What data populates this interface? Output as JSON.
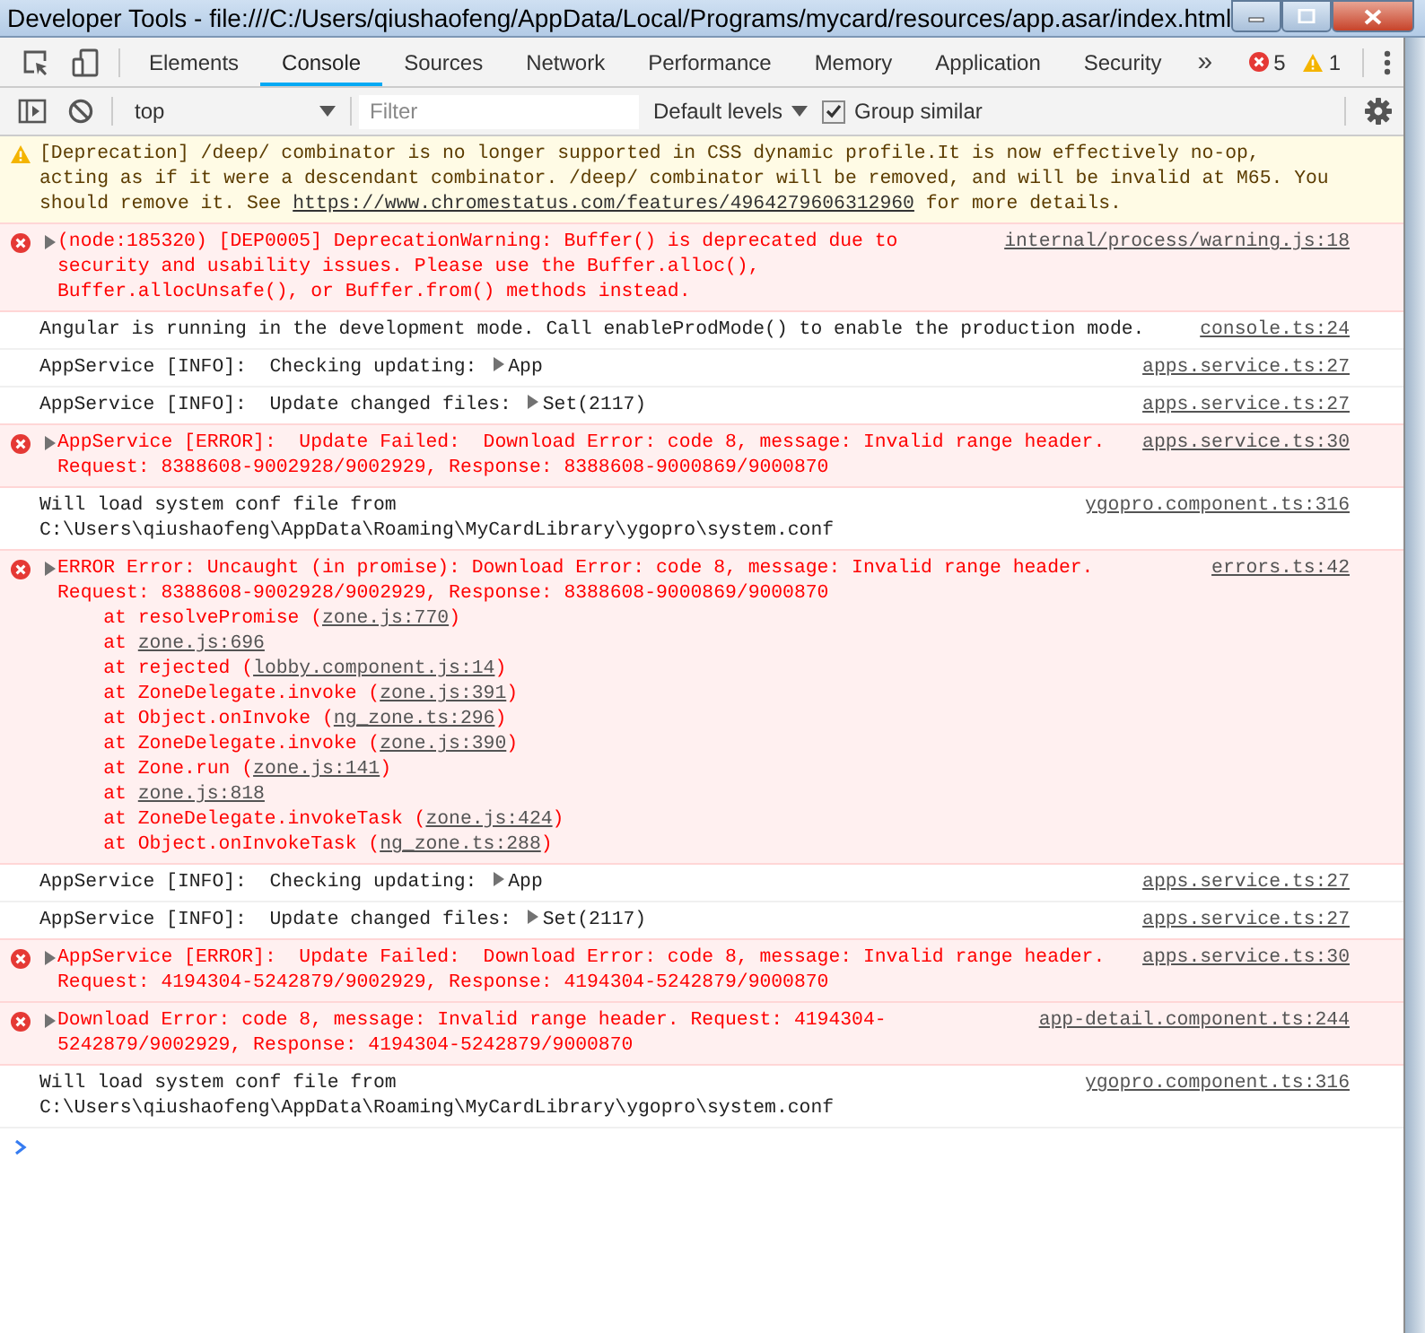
{
  "window": {
    "title": "Developer Tools - file:///C:/Users/qiushaofeng/AppData/Local/Programs/mycard/resources/app.asar/index.html"
  },
  "tabs": [
    {
      "label": "Elements",
      "selected": false
    },
    {
      "label": "Console",
      "selected": true
    },
    {
      "label": "Sources",
      "selected": false
    },
    {
      "label": "Network",
      "selected": false
    },
    {
      "label": "Performance",
      "selected": false
    },
    {
      "label": "Memory",
      "selected": false
    },
    {
      "label": "Application",
      "selected": false
    },
    {
      "label": "Security",
      "selected": false
    }
  ],
  "overflow": "»",
  "counts": {
    "errors": "5",
    "warnings": "1"
  },
  "toolbar": {
    "context": "top",
    "filter": {
      "placeholder": "Filter"
    },
    "levels": "Default levels",
    "group_similar": {
      "label": "Group similar",
      "checked": true
    }
  },
  "messages": [
    {
      "kind": "warning",
      "expandable": false,
      "args": [
        {
          "kind": "string",
          "text": "[Deprecation] /deep/ combinator is no longer supported in CSS dynamic profile.It is now effectively no-op, acting as if it were a descendant combinator. /deep/ combinator will be removed, and will be invalid at M65. You should remove it. See ",
          "link": "https://www.chromestatus.com/features/4964279606312960",
          "after": " for more details."
        }
      ]
    },
    {
      "kind": "error",
      "expandable": true,
      "source": "internal/process/warning.js:18",
      "args": [
        {
          "kind": "string",
          "text": "(node:185320) [DEP0005] DeprecationWarning: Buffer() is deprecated due to security and usability issues. Please use the Buffer.alloc(), Buffer.allocUnsafe(), or Buffer.from() methods instead."
        }
      ]
    },
    {
      "kind": "info",
      "expandable": false,
      "source": "console.ts:24",
      "args": [
        {
          "kind": "string",
          "text": "Angular is running in the development mode. Call enableProdMode() to enable the production mode."
        }
      ]
    },
    {
      "kind": "info",
      "expandable": false,
      "source": "apps.service.ts:27",
      "args": [
        {
          "kind": "string",
          "text": "AppService [INFO]:  Checking updating: "
        },
        {
          "kind": "object",
          "text": "App"
        }
      ]
    },
    {
      "kind": "info",
      "expandable": false,
      "source": "apps.service.ts:27",
      "args": [
        {
          "kind": "string",
          "text": "AppService [INFO]:  Update changed files: "
        },
        {
          "kind": "object",
          "text": "Set(2117)"
        }
      ]
    },
    {
      "kind": "error",
      "expandable": true,
      "source": "apps.service.ts:30",
      "args": [
        {
          "kind": "string",
          "text": "AppService [ERROR]:  Update Failed:  Download Error: code 8, message: Invalid range header. Request: 8388608-9002928/9002929, Response: 8388608-9000869/9000870"
        }
      ]
    },
    {
      "kind": "info",
      "expandable": false,
      "source": "ygopro.component.ts:316",
      "args": [
        {
          "kind": "string",
          "text": "Will load system conf file from C:\\Users\\qiushaofeng\\AppData\\Roaming\\MyCardLibrary\\ygopro\\system.conf"
        }
      ]
    },
    {
      "kind": "error",
      "expandable": true,
      "source": "errors.ts:42",
      "args": [
        {
          "kind": "string",
          "text": "ERROR Error: Uncaught (in promise): Download Error: code 8, message: Invalid range header. Request: 8388608-9002928/9002929, Response: 8388608-9000869/9000870"
        }
      ],
      "stack": [
        {
          "text": "at resolvePromise (",
          "link": "zone.js:770",
          "after": ")"
        },
        {
          "text": "at ",
          "link": "zone.js:696"
        },
        {
          "text": "at rejected (",
          "link": "lobby.component.js:14",
          "after": ")"
        },
        {
          "text": "at ZoneDelegate.invoke (",
          "link": "zone.js:391",
          "after": ")"
        },
        {
          "text": "at Object.onInvoke (",
          "link": "ng_zone.ts:296",
          "after": ")"
        },
        {
          "text": "at ZoneDelegate.invoke (",
          "link": "zone.js:390",
          "after": ")"
        },
        {
          "text": "at Zone.run (",
          "link": "zone.js:141",
          "after": ")"
        },
        {
          "text": "at ",
          "link": "zone.js:818"
        },
        {
          "text": "at ZoneDelegate.invokeTask (",
          "link": "zone.js:424",
          "after": ")"
        },
        {
          "text": "at Object.onInvokeTask (",
          "link": "ng_zone.ts:288",
          "after": ")"
        }
      ]
    },
    {
      "kind": "info",
      "expandable": false,
      "source": "apps.service.ts:27",
      "args": [
        {
          "kind": "string",
          "text": "AppService [INFO]:  Checking updating: "
        },
        {
          "kind": "object",
          "text": "App"
        }
      ]
    },
    {
      "kind": "info",
      "expandable": false,
      "source": "apps.service.ts:27",
      "args": [
        {
          "kind": "string",
          "text": "AppService [INFO]:  Update changed files: "
        },
        {
          "kind": "object",
          "text": "Set(2117)"
        }
      ]
    },
    {
      "kind": "error",
      "expandable": true,
      "source": "apps.service.ts:30",
      "args": [
        {
          "kind": "string",
          "text": "AppService [ERROR]:  Update Failed:  Download Error: code 8, message: Invalid range header. Request: 4194304-5242879/9002929, Response: 4194304-5242879/9000870"
        }
      ]
    },
    {
      "kind": "error",
      "expandable": true,
      "source": "app-detail.component.ts:244",
      "args": [
        {
          "kind": "string",
          "text": "Download Error: code 8, message: Invalid range header. Request: 4194304-5242879/9002929, Response: 4194304-5242879/9000870"
        }
      ]
    },
    {
      "kind": "info",
      "expandable": false,
      "source": "ygopro.component.ts:316",
      "args": [
        {
          "kind": "string",
          "text": "Will load system conf file from C:\\Users\\qiushaofeng\\AppData\\Roaming\\MyCardLibrary\\ygopro\\system.conf"
        }
      ]
    }
  ]
}
